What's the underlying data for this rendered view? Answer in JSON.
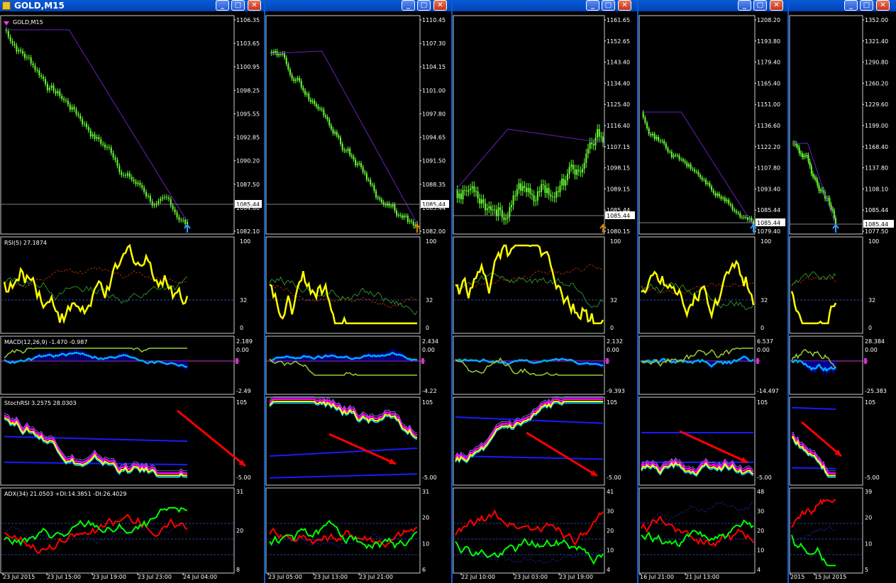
{
  "windows": [
    {
      "id": "w1",
      "title": "GOLD,M15",
      "active": true,
      "chart_label": "GOLD,M15",
      "price_scale": [
        "1106.35",
        "1103.65",
        "1100.95",
        "1098.25",
        "1095.55",
        "1092.85",
        "1090.20",
        "1087.50",
        "1084.80",
        "1082.10"
      ],
      "current_price": "1085.44",
      "rsi_label": "RSI(5) 27.1874",
      "rsi_scale": [
        "100",
        "32",
        "0"
      ],
      "macd_label": "MACD(12,26,9) -1.470 -0.987",
      "macd_scale": [
        "2.189",
        "0.00",
        "-2.49"
      ],
      "stoch_label": "StochRSI 3.2575 28.0303",
      "stoch_scale": [
        "105",
        "-5.00"
      ],
      "adx_label": "ADX(34) 21.0503 +DI:14.3851 -DI:26.4029",
      "adx_scale": [
        "31",
        "20",
        "8"
      ],
      "time_labels": [
        "23 Jul 2015",
        "23 Jul 15:00",
        "23 Jul 19:00",
        "23 Jul 23:00",
        "24 Jul 04:00"
      ]
    },
    {
      "id": "w2",
      "title": "",
      "active": false,
      "price_scale": [
        "1110.45",
        "1107.30",
        "1104.15",
        "1101.00",
        "1097.80",
        "1094.65",
        "1091.50",
        "1088.35",
        "1085.44",
        "1082.00"
      ],
      "current_price": "1085.44",
      "rsi_scale": [
        "100",
        "32",
        "0"
      ],
      "macd_scale": [
        "2.434",
        "0.00",
        "-4.22"
      ],
      "stoch_scale": [
        "105",
        "-5.00"
      ],
      "adx_scale": [
        "31",
        "20",
        "10",
        "6"
      ],
      "time_labels": [
        "23 Jul 05:00",
        "23 Jul 13:00",
        "23 Jul 21:00"
      ]
    },
    {
      "id": "w3",
      "title": "",
      "active": false,
      "price_scale": [
        "1161.65",
        "1152.65",
        "1143.40",
        "1134.40",
        "1125.40",
        "1116.40",
        "1107.15",
        "1098.15",
        "1089.15",
        "1085.44",
        "1080.15"
      ],
      "current_price": "1085.44",
      "rsi_scale": [
        "100",
        "32",
        "0"
      ],
      "macd_scale": [
        "2.132",
        "0.00",
        "-9.393"
      ],
      "stoch_scale": [
        "105",
        "-5.00"
      ],
      "adx_scale": [
        "41",
        "30",
        "20",
        "10",
        "4"
      ],
      "time_labels": [
        "22 Jul 10:00",
        "23 Jul 03:00",
        "23 Jul 19:00"
      ]
    },
    {
      "id": "w4",
      "title": "",
      "active": false,
      "price_scale": [
        "1208.20",
        "1193.80",
        "1179.40",
        "1165.40",
        "1151.00",
        "1136.60",
        "1122.20",
        "1107.80",
        "1093.40",
        "1085.44",
        "1079.40"
      ],
      "current_price": "1085.44",
      "rsi_scale": [
        "100",
        "32",
        "0"
      ],
      "macd_scale": [
        "6.537",
        "0.00",
        "-14.497"
      ],
      "stoch_scale": [
        "105",
        "-5.00"
      ],
      "adx_scale": [
        "48",
        "30",
        "20",
        "10",
        "4"
      ],
      "time_labels": [
        "16 Jul 21:00",
        "21 Jul 13:00"
      ]
    },
    {
      "id": "w5",
      "title": "",
      "active": false,
      "price_scale": [
        "1352.00",
        "1321.40",
        "1290.80",
        "1260.20",
        "1229.60",
        "1199.00",
        "1168.40",
        "1137.80",
        "1108.10",
        "1085.44",
        "1077.50"
      ],
      "current_price": "1085.44",
      "rsi_scale": [
        "100",
        "32",
        "0"
      ],
      "macd_scale": [
        "28.384",
        "0.00",
        "-25.383"
      ],
      "stoch_scale": [
        "105",
        "-5.00"
      ],
      "adx_scale": [
        "39",
        "20",
        "10",
        "5"
      ],
      "time_labels": [
        "2015",
        "15 Jul 2015"
      ]
    }
  ],
  "buttons": {
    "minimize": "_",
    "maximize": "□",
    "close": "✕"
  },
  "colors": {
    "candle": "#66ff33",
    "rsi": "#ffff00",
    "macd_hist": "#0000ff",
    "macd_signal": "#00aaff",
    "adx_plus": "#00ff00",
    "adx_minus": "#ff0000",
    "arrow": "#ff0000",
    "titlebar": "#0a5bd6"
  }
}
